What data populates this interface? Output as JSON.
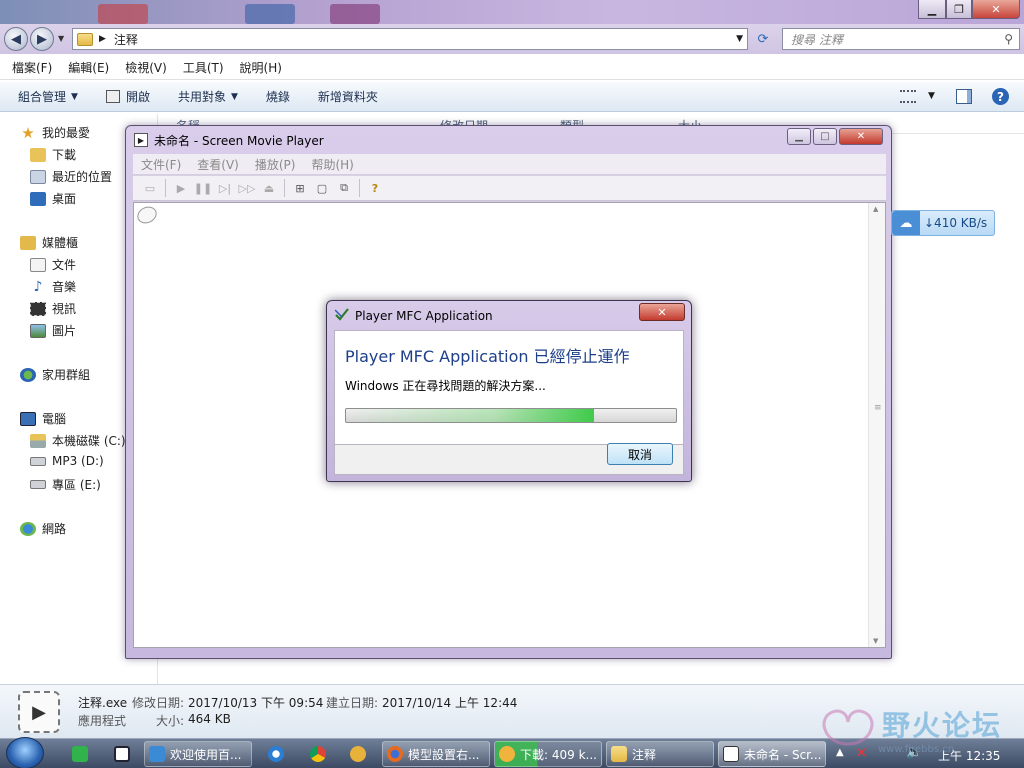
{
  "explorer": {
    "address": "注释",
    "search_placeholder": "搜尋 注釋",
    "menu": [
      "檔案(F)",
      "編輯(E)",
      "檢視(V)",
      "工具(T)",
      "說明(H)"
    ],
    "commands": {
      "organize": "組合管理",
      "open": "開啟",
      "share": "共用對象",
      "burn": "燒錄",
      "new_folder": "新增資料夾"
    },
    "columns": [
      "名稱",
      "修改日期",
      "類型",
      "大小"
    ],
    "nav": {
      "favorites": "我的最愛",
      "downloads": "下載",
      "recent": "最近的位置",
      "desktop": "桌面",
      "libraries": "媒體櫃",
      "documents": "文件",
      "music": "音樂",
      "videos": "視訊",
      "pictures": "圖片",
      "homegroup": "家用群組",
      "computer": "電腦",
      "drive_c": "本機磁碟 (C:)",
      "drive_d": "MP3 (D:)",
      "drive_e": "專區 (E:)",
      "network": "網路"
    },
    "details": {
      "filename": "注释.exe",
      "modified_label": "修改日期:",
      "modified_value": "2017/10/13 下午 09:54",
      "created_label": "建立日期:",
      "created_value": "2017/10/14 上午 12:44",
      "type": "應用程式",
      "size_label": "大小:",
      "size_value": "464 KB"
    }
  },
  "player": {
    "title": "未命名 - Screen Movie Player",
    "menu": [
      "文件(F)",
      "查看(V)",
      "播放(P)",
      "帮助(H)"
    ]
  },
  "dialog": {
    "title": "Player MFC Application",
    "heading": "Player MFC Application 已經停止運作",
    "message": "Windows 正在尋找問題的解決方案...",
    "progress": 0.75,
    "cancel": "取消"
  },
  "speed_widget": {
    "text": "↓410 KB/s"
  },
  "taskbar": {
    "tasks": [
      "欢迎使用百...",
      "模型設置右...",
      "下載: 409 k...",
      "注释",
      "未命名 - Scr..."
    ],
    "clock": "上午 12:35"
  },
  "watermark": {
    "text": "野火论坛",
    "sub": "www.firebbs.cn"
  },
  "colors": {
    "accent_purple": "#c9b6e0",
    "heading_blue": "#1d3f8a",
    "progress_green": "#3fcb4a",
    "close_red": "#c33b2f"
  }
}
